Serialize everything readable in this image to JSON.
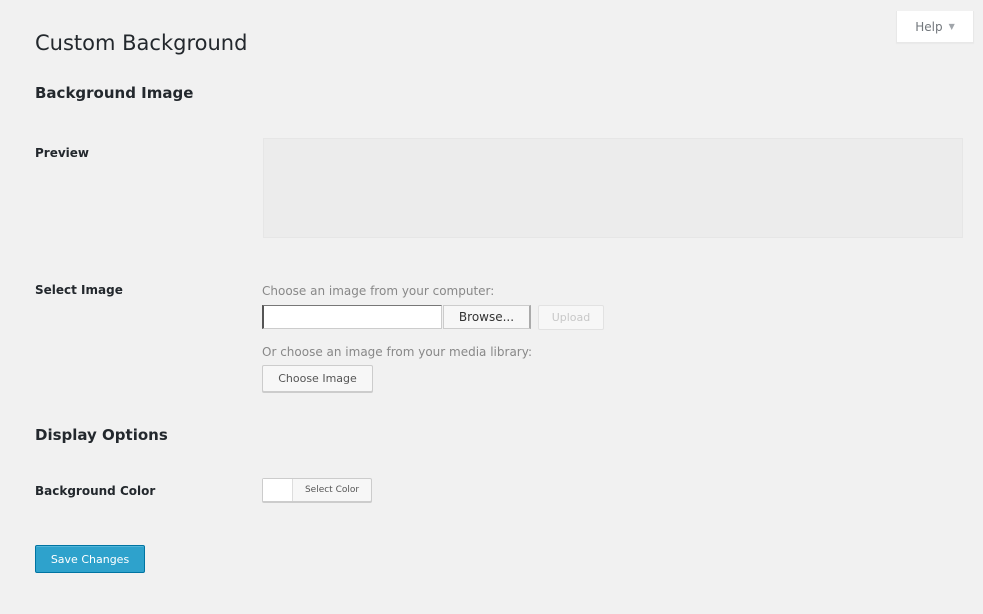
{
  "header": {
    "title": "Custom Background",
    "help_label": "Help"
  },
  "sections": {
    "background_image": "Background Image",
    "display_options": "Display Options"
  },
  "rows": {
    "preview": "Preview",
    "select_image": "Select Image",
    "background_color": "Background Color"
  },
  "select_image": {
    "computer_hint": "Choose an image from your computer:",
    "browse_label": "Browse...",
    "upload_label": "Upload",
    "file_value": "",
    "library_hint": "Or choose an image from your media library:",
    "choose_label": "Choose Image"
  },
  "color": {
    "select_label": "Select Color",
    "swatch_color": "#ffffff"
  },
  "actions": {
    "save_label": "Save Changes"
  },
  "colors": {
    "primary": "#2ea2cc",
    "page_bg": "#f1f1f1"
  },
  "icons": {
    "help_arrow": "caret-down-icon"
  }
}
